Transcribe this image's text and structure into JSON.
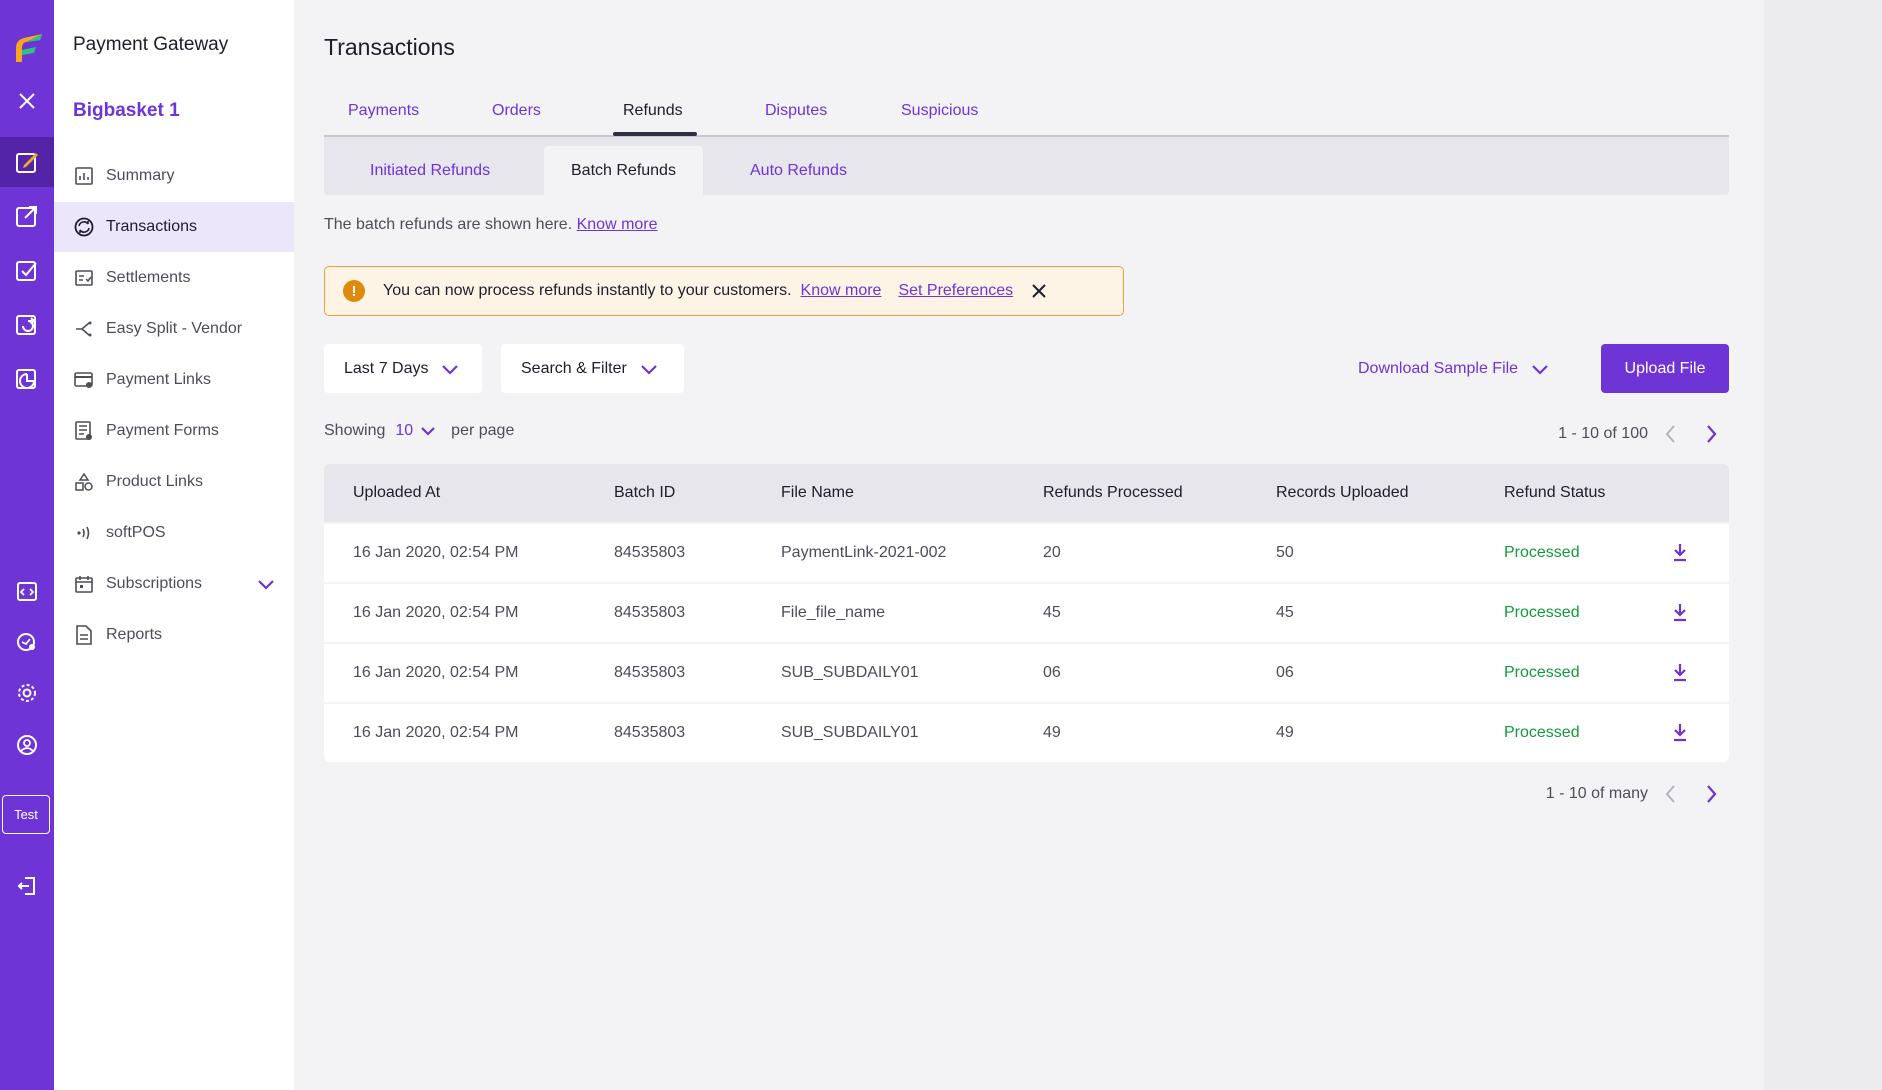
{
  "rail": {
    "test_label": "Test"
  },
  "sidebar": {
    "product": "Payment Gateway",
    "merchant": "Bigbasket 1",
    "items": [
      {
        "label": "Summary",
        "icon": "bar-chart-icon"
      },
      {
        "label": "Transactions",
        "icon": "transactions-icon"
      },
      {
        "label": "Settlements",
        "icon": "settlements-icon"
      },
      {
        "label": "Easy Split -  Vendor",
        "icon": "split-icon"
      },
      {
        "label": "Payment Links",
        "icon": "payment-link-icon"
      },
      {
        "label": "Payment Forms",
        "icon": "payment-form-icon"
      },
      {
        "label": "Product Links",
        "icon": "product-link-icon"
      },
      {
        "label": "softPOS",
        "icon": "softpos-icon"
      },
      {
        "label": "Subscriptions",
        "icon": "calendar-icon"
      },
      {
        "label": "Reports",
        "icon": "report-icon"
      }
    ]
  },
  "main": {
    "title": "Transactions",
    "tabs": [
      "Payments",
      "Orders",
      "Refunds",
      "Disputes",
      "Suspicious"
    ],
    "active_tab": "Refunds",
    "subtabs": [
      "Initiated Refunds",
      "Batch Refunds",
      "Auto Refunds"
    ],
    "active_subtab": "Batch Refunds",
    "info_text": "The batch refunds are shown here.",
    "info_link": "Know more",
    "banner": {
      "text": "You can now process refunds instantly to your customers.",
      "link1": "Know more",
      "link2": "Set Preferences"
    },
    "filters": {
      "date_range": "Last 7 Days",
      "search_filter": "Search & Filter"
    },
    "download_sample": "Download Sample File",
    "upload_button": "Upload File",
    "showing_label": "Showing",
    "per_page_value": "10",
    "per_page_label": "per page",
    "pager_top": "1 - 10 of 100",
    "pager_bottom": "1 - 10 of many",
    "table": {
      "columns": [
        "Uploaded At",
        "Batch ID",
        "File Name",
        "Refunds Processed",
        "Records Uploaded",
        "Refund Status"
      ],
      "rows": [
        {
          "uploaded_at": "16 Jan 2020, 02:54 PM",
          "batch_id": "84535803",
          "file_name": "PaymentLink-2021-002",
          "refunds_processed": "20",
          "records_uploaded": "50",
          "status": "Processed"
        },
        {
          "uploaded_at": "16 Jan 2020, 02:54 PM",
          "batch_id": "84535803",
          "file_name": "File_file_name",
          "refunds_processed": "45",
          "records_uploaded": "45",
          "status": "Processed"
        },
        {
          "uploaded_at": "16 Jan 2020, 02:54 PM",
          "batch_id": "84535803",
          "file_name": "SUB_SUBDAILY01",
          "refunds_processed": "06",
          "records_uploaded": "06",
          "status": "Processed"
        },
        {
          "uploaded_at": "16 Jan 2020, 02:54 PM",
          "batch_id": "84535803",
          "file_name": "SUB_SUBDAILY01",
          "refunds_processed": "49",
          "records_uploaded": "49",
          "status": "Processed"
        }
      ]
    }
  },
  "colors": {
    "brand": "#6f34d6",
    "status_processed": "#109b3a",
    "warning": "#e08a0c"
  }
}
